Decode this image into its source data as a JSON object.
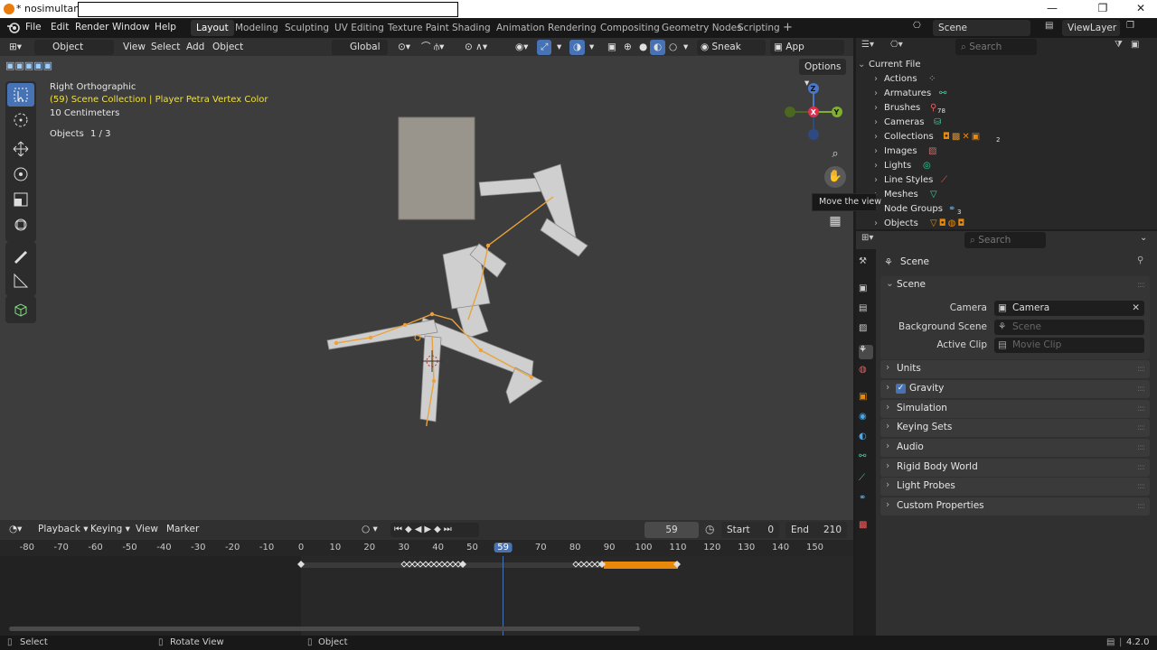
{
  "window": {
    "title": "* nosimultanim",
    "minimize": "—",
    "maximize": "❐",
    "close": "✕"
  },
  "menu": [
    "File",
    "Edit",
    "Render",
    "Window",
    "Help"
  ],
  "workspaces": [
    {
      "label": "Layout",
      "active": true
    },
    {
      "label": "Modeling"
    },
    {
      "label": "Sculpting"
    },
    {
      "label": "UV Editing"
    },
    {
      "label": "Texture Paint"
    },
    {
      "label": "Shading"
    },
    {
      "label": "Animation"
    },
    {
      "label": "Rendering"
    },
    {
      "label": "Compositing"
    },
    {
      "label": "Geometry Nodes"
    },
    {
      "label": "Scripting"
    }
  ],
  "add_workspace": "+",
  "scene_field": "Scene",
  "viewlayer_field": "ViewLayer",
  "viewport_header": {
    "mode": "Object Mode",
    "view": "View",
    "select": "Select",
    "add": "Add",
    "object": "Object",
    "orientation": "Global",
    "sneak_peek": "Sneak Peek",
    "app_manager": "App Manager",
    "options": "Options"
  },
  "viewport": {
    "view_name": "Right Orthographic",
    "collection_info": "(59) Scene Collection | Player Petra Vertex Color",
    "scale": "10 Centimeters",
    "objects_label": "Objects",
    "objects_count": "1 / 3",
    "tooltip": "Move the view",
    "gizmo": {
      "z": "Z",
      "x": "X",
      "y": "Y"
    }
  },
  "timeline": {
    "playback": "Playback",
    "keying": "Keying",
    "view": "View",
    "marker": "Marker",
    "current_frame": "59",
    "start_label": "Start",
    "start": "0",
    "end_label": "End",
    "end": "210",
    "ticks": [
      "-80",
      "-70",
      "-60",
      "-50",
      "-40",
      "-30",
      "-20",
      "-10",
      "0",
      "10",
      "20",
      "30",
      "40",
      "50",
      "59",
      "70",
      "80",
      "90",
      "100",
      "110",
      "120",
      "130",
      "140",
      "150"
    ]
  },
  "outliner": {
    "search_placeholder": "Search",
    "root": "Current File",
    "items": [
      {
        "label": "Actions",
        "badge": ""
      },
      {
        "label": "Armatures",
        "badge": ""
      },
      {
        "label": "Brushes",
        "badge": "78"
      },
      {
        "label": "Cameras",
        "badge": ""
      },
      {
        "label": "Collections",
        "badge": "2"
      },
      {
        "label": "Images",
        "badge": ""
      },
      {
        "label": "Lights",
        "badge": ""
      },
      {
        "label": "Line Styles",
        "badge": ""
      },
      {
        "label": "Meshes",
        "badge": ""
      },
      {
        "label": "Node Groups",
        "badge": "3"
      },
      {
        "label": "Objects",
        "badge": ""
      }
    ]
  },
  "properties": {
    "search_placeholder": "Search",
    "context": "Scene",
    "scene_panel": "Scene",
    "camera_label": "Camera",
    "camera_value": "Camera",
    "background_label": "Background Scene",
    "background_placeholder": "Scene",
    "clip_label": "Active Clip",
    "clip_placeholder": "Movie Clip",
    "panels": [
      "Units",
      "Gravity",
      "Simulation",
      "Keying Sets",
      "Audio",
      "Rigid Body World",
      "Light Probes",
      "Custom Properties"
    ]
  },
  "status": {
    "select": "Select",
    "rotate": "Rotate View",
    "object": "Object",
    "version": "4.2.0"
  },
  "colors": {
    "accent": "#4772b3",
    "keyframe_selected": "#e8890c",
    "playhead": "#4772b3",
    "bone_orange": "#e8a33c"
  }
}
